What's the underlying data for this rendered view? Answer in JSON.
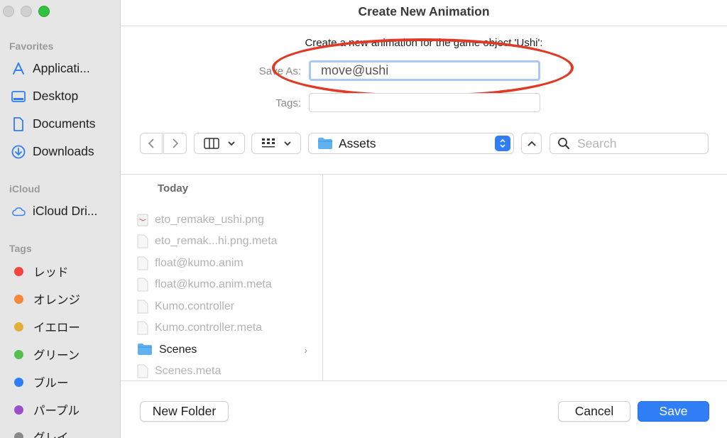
{
  "window": {
    "title": "Create New Animation"
  },
  "sidebar": {
    "favorites_title": "Favorites",
    "favorites": [
      {
        "label": "Applicati...",
        "icon": "applications-icon"
      },
      {
        "label": "Desktop",
        "icon": "desktop-icon"
      },
      {
        "label": "Documents",
        "icon": "documents-icon"
      },
      {
        "label": "Downloads",
        "icon": "downloads-icon"
      }
    ],
    "icloud_title": "iCloud",
    "icloud": [
      {
        "label": "iCloud Dri...",
        "icon": "cloud-icon"
      }
    ],
    "tags_title": "Tags",
    "tags": [
      {
        "label": "レッド",
        "color": "#f2453d"
      },
      {
        "label": "オレンジ",
        "color": "#f3873b"
      },
      {
        "label": "イエロー",
        "color": "#e5ad3a"
      },
      {
        "label": "グリーン",
        "color": "#52c04a"
      },
      {
        "label": "ブルー",
        "color": "#2f7ef6"
      },
      {
        "label": "パープル",
        "color": "#9b4fc9"
      },
      {
        "label": "グレイ",
        "color": "#8a8a8a"
      }
    ]
  },
  "form": {
    "prompt": "Create a new animation for the game object 'Ushi':",
    "save_as_label": "Save As:",
    "save_as_value": "move@ushi",
    "tags_label": "Tags:",
    "tags_value": ""
  },
  "toolbar": {
    "location": "Assets",
    "search_placeholder": "Search"
  },
  "browser": {
    "group_header": "Today",
    "files": [
      {
        "name": "eto_remake_ushi.png",
        "enabled": false
      },
      {
        "name": "eto_remak...hi.png.meta",
        "enabled": false
      },
      {
        "name": "float@kumo.anim",
        "enabled": false
      },
      {
        "name": "float@kumo.anim.meta",
        "enabled": false
      },
      {
        "name": "Kumo.controller",
        "enabled": false
      },
      {
        "name": "Kumo.controller.meta",
        "enabled": false
      },
      {
        "name": "Scenes",
        "enabled": true,
        "folder": true
      },
      {
        "name": "Scenes.meta",
        "enabled": false
      }
    ]
  },
  "footer": {
    "new_folder": "New Folder",
    "cancel": "Cancel",
    "save": "Save"
  },
  "colors": {
    "accent": "#2f7ef6",
    "annotation": "#e03a26"
  }
}
